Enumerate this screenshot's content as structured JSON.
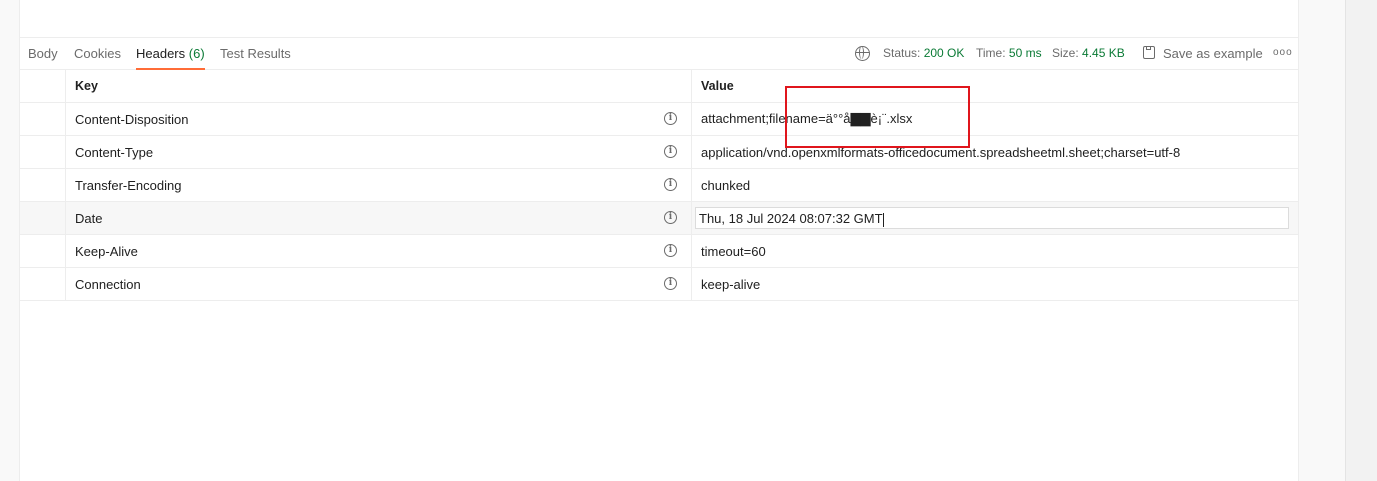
{
  "tabs": {
    "body": "Body",
    "cookies": "Cookies",
    "headers": "Headers",
    "headers_count": "(6)",
    "test_results": "Test Results"
  },
  "meta": {
    "status_label": "Status:",
    "status_value": "200 OK",
    "time_label": "Time:",
    "time_value": "50 ms",
    "size_label": "Size:",
    "size_value": "4.45 KB",
    "save_example": "Save as example",
    "more": "ooo"
  },
  "columns": {
    "key": "Key",
    "value": "Value"
  },
  "rows": [
    {
      "key": "Content-Disposition",
      "value": "attachment;filename=ä°°å▇▇è¡¨.xlsx"
    },
    {
      "key": "Content-Type",
      "value": "application/vnd.openxmlformats-officedocument.spreadsheetml.sheet;charset=utf-8"
    },
    {
      "key": "Transfer-Encoding",
      "value": "chunked"
    },
    {
      "key": "Date",
      "value": "Thu, 18 Jul 2024 08:07:32 GMT"
    },
    {
      "key": "Keep-Alive",
      "value": "timeout=60"
    },
    {
      "key": "Connection",
      "value": "keep-alive"
    }
  ],
  "info_glyph": "i",
  "colors": {
    "accent": "#ff6c37",
    "success": "#0a7a35",
    "highlight": "#e0151c"
  }
}
